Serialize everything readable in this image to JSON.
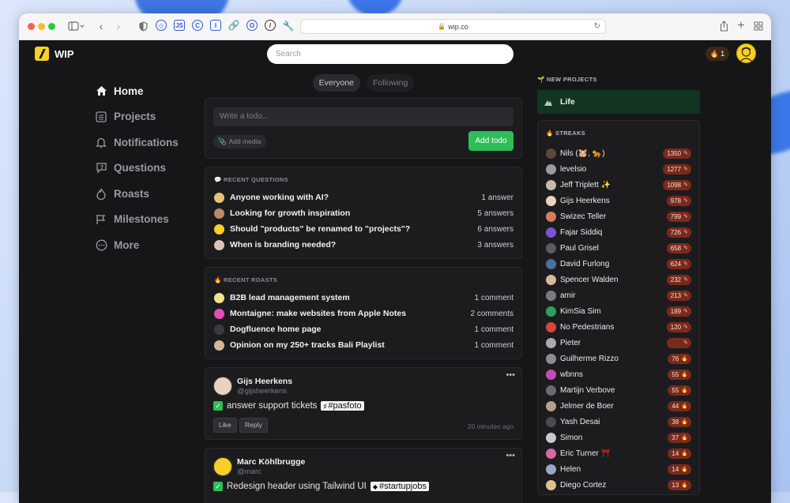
{
  "browser": {
    "url": "wip.co"
  },
  "app": {
    "logo_text": "WIP",
    "search_placeholder": "Search",
    "streak_count": "1"
  },
  "nav": [
    {
      "label": "Home",
      "icon": "home-icon",
      "active": true
    },
    {
      "label": "Projects",
      "icon": "projects-icon",
      "active": false
    },
    {
      "label": "Notifications",
      "icon": "bell-icon",
      "active": false
    },
    {
      "label": "Questions",
      "icon": "question-icon",
      "active": false
    },
    {
      "label": "Roasts",
      "icon": "fire-icon",
      "active": false
    },
    {
      "label": "Milestones",
      "icon": "milestone-icon",
      "active": false
    },
    {
      "label": "More",
      "icon": "more-icon",
      "active": false
    }
  ],
  "feed_tabs": {
    "everyone": "Everyone",
    "following": "Following"
  },
  "composer": {
    "placeholder": "Write a todo...",
    "add_media": "Add media",
    "submit": "Add todo"
  },
  "recent_questions": {
    "title": "RECENT QUESTIONS",
    "items": [
      {
        "title": "Anyone working with AI?",
        "count": "1 answer",
        "color": "#e9c27a"
      },
      {
        "title": "Looking for growth inspiration",
        "count": "5 answers",
        "color": "#b98b6b"
      },
      {
        "title": "Should \"products\" be renamed to \"projects\"?",
        "count": "6 answers",
        "color": "#f6d026"
      },
      {
        "title": "When is branding needed?",
        "count": "3 answers",
        "color": "#d9c6b5"
      }
    ]
  },
  "recent_roasts": {
    "title": "RECENT ROASTS",
    "items": [
      {
        "title": "B2B lead management system",
        "count": "1 comment",
        "color": "#f6e28a"
      },
      {
        "title": "Montaigne: make websites from Apple Notes",
        "count": "2 comments",
        "color": "#e44bb5"
      },
      {
        "title": "Dogfluence home page",
        "count": "1 comment",
        "color": "#3b3b3b"
      },
      {
        "title": "Opinion on my 250+ tracks Bali Playlist",
        "count": "1 comment",
        "color": "#d4b896"
      }
    ]
  },
  "posts": [
    {
      "name": "Gijs Heerkens",
      "handle": "@gijsheerkens",
      "todo": "answer support tickets",
      "tag": "#pasfoto",
      "like": "Like",
      "reply": "Reply",
      "time": "20 minutes ago",
      "color": "#e8d3c0"
    },
    {
      "name": "Marc Köhlbrugge",
      "handle": "@marc",
      "todo": "Redesign header using Tailwind UI",
      "tag": "#startupjobs",
      "color": "#f6d026"
    }
  ],
  "new_projects": {
    "title": "NEW PROJECTS",
    "items": [
      {
        "name": "Life"
      }
    ]
  },
  "streaks": {
    "title": "STREAKS",
    "items": [
      {
        "name": "Nils (🐹, 🐆)",
        "value": "1350",
        "color": "#5b4a3a"
      },
      {
        "name": "levelsio",
        "value": "1277",
        "color": "#9a9aa0"
      },
      {
        "name": "Jeff Triplett ✨",
        "value": "1098",
        "color": "#c9b9a8"
      },
      {
        "name": "Gijs Heerkens",
        "value": "978",
        "color": "#e8d3c0"
      },
      {
        "name": "Swizec Teller",
        "value": "799",
        "color": "#d67d5c"
      },
      {
        "name": "Fajar Siddiq",
        "value": "726",
        "color": "#7b53d6"
      },
      {
        "name": "Paul Grisel",
        "value": "658",
        "color": "#5a5a60"
      },
      {
        "name": "David Furlong",
        "value": "624",
        "color": "#4a6fa0"
      },
      {
        "name": "Spencer Walden",
        "value": "232",
        "color": "#d6b89c"
      },
      {
        "name": "amir",
        "value": "213",
        "color": "#7a7a80"
      },
      {
        "name": "KimSia Sim",
        "value": "189",
        "color": "#2f9f5a"
      },
      {
        "name": "No Pedestrians",
        "value": "120",
        "color": "#d9463a"
      },
      {
        "name": "Pieter",
        "value": "",
        "color": "#aaa"
      },
      {
        "name": "Guilherme Rizzo",
        "value": "76",
        "color": "#8c8c92"
      },
      {
        "name": "wbnns",
        "value": "55",
        "color": "#c44bb5"
      },
      {
        "name": "Martijn Verbove",
        "value": "55",
        "color": "#6a6a70"
      },
      {
        "name": "Jelmer de Boer",
        "value": "44",
        "color": "#b6a08a"
      },
      {
        "name": "Yash Desai",
        "value": "38",
        "color": "#4a4a50"
      },
      {
        "name": "Simon",
        "value": "37",
        "color": "#c8c8cc"
      },
      {
        "name": "Eric Turner ⛩️",
        "value": "14",
        "color": "#d66aa0"
      },
      {
        "name": "Helen",
        "value": "14",
        "color": "#9aa6c8"
      },
      {
        "name": "Diego Cortez",
        "value": "13",
        "color": "#e0c08a"
      }
    ]
  }
}
